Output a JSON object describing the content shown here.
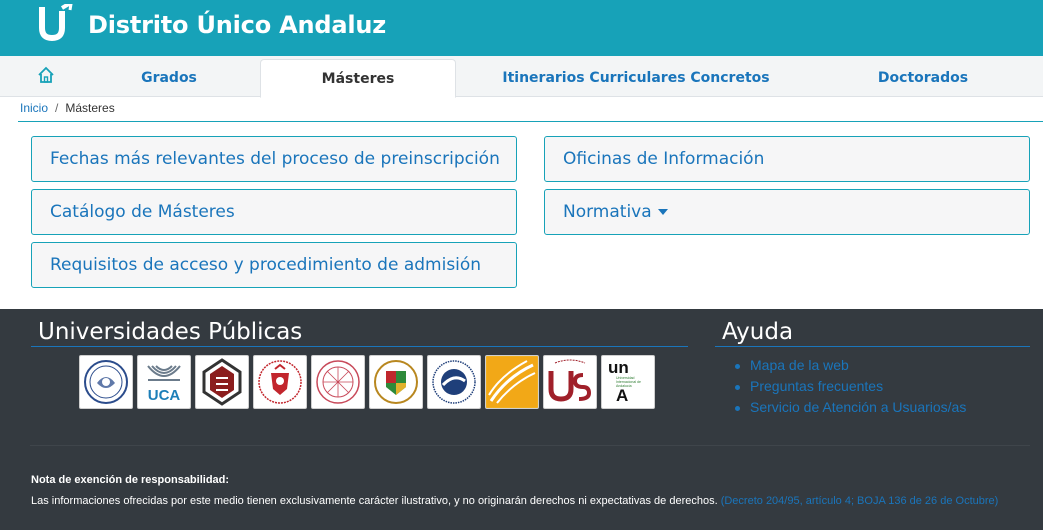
{
  "header": {
    "title": "Distrito Único Andaluz",
    "logo_icon": "du-logo-icon",
    "brand_color": "#17a2b8"
  },
  "nav": {
    "home_icon": "home-icon",
    "tabs": [
      {
        "label": "Grados",
        "active": false
      },
      {
        "label": "Másteres",
        "active": true
      },
      {
        "label": "Itinerarios Curriculares Concretos",
        "active": false
      },
      {
        "label": "Doctorados",
        "active": false
      }
    ]
  },
  "breadcrumb": {
    "home": "Inicio",
    "separator": "/",
    "current": "Másteres"
  },
  "menu": {
    "fechas": "Fechas más relevantes del proceso de preinscripción",
    "catalogo": "Catálogo de Másteres",
    "requisitos": "Requisitos de acceso y procedimiento de admisión",
    "oficinas": "Oficinas de Información",
    "normativa": "Normativa"
  },
  "footer": {
    "universities_title": "Universidades Públicas",
    "universities": [
      {
        "name": "Universidad de Almería",
        "icon": "ual-seal-icon"
      },
      {
        "name": "Universidad de Cádiz",
        "icon": "uca-logo-icon",
        "text": "UCA"
      },
      {
        "name": "Universidad de Córdoba",
        "icon": "uco-logo-icon"
      },
      {
        "name": "Universidad de Granada",
        "icon": "ugr-seal-icon"
      },
      {
        "name": "Universidad de Huelva",
        "icon": "uhu-seal-icon"
      },
      {
        "name": "Universidad de Jaén",
        "icon": "ujaen-seal-icon"
      },
      {
        "name": "Universidad de Málaga",
        "icon": "uma-seal-icon"
      },
      {
        "name": "Universidad Pablo de Olavide",
        "icon": "upo-logo-icon"
      },
      {
        "name": "Universidad de Sevilla",
        "icon": "us-logo-icon"
      },
      {
        "name": "Universidad Internacional de Andalucía",
        "icon": "unia-logo-icon",
        "text_top": "un",
        "text_bottom": "A",
        "small_text": "Universidad Internacional de Andalucía"
      }
    ],
    "help_title": "Ayuda",
    "help_links": [
      "Mapa de la web",
      "Preguntas frecuentes",
      "Servicio de Atención a Usuarios/as"
    ],
    "disclaimer_title": "Nota de exención de responsabilidad:",
    "disclaimer_text": "Las informaciones ofrecidas por este medio tienen exclusivamente carácter ilustrativo, y no originarán derechos ni expectativas de derechos.",
    "disclaimer_link": "(Decreto 204/95, artículo 4; BOJA 136 de 26 de Octubre)",
    "footer_bg": "#343a40",
    "link_color": "#1a75bb"
  }
}
